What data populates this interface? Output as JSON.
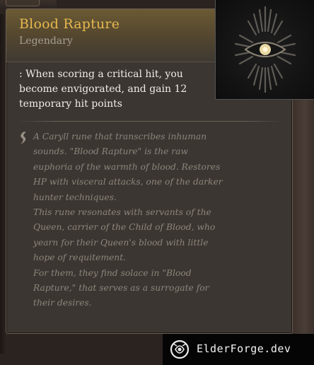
{
  "tooltip": {
    "title": "Blood Rapture",
    "rarity": "Legendary",
    "effect": ": When scoring a critical hit, you become envigorated, and gain 12 temporary hit points",
    "lore": [
      "A Caryll rune that transcribes inhuman sounds. \"Blood Rapture\" is the raw euphoria of the warmth of blood. Restores HP with visceral attacks, one of the darker hunter techniques.",
      "This rune resonates with servants of the Queen, carrier of the Child of Blood, who yearn for their Queen's blood with little hope of requitement.",
      "For them, they find solace in \"Blood Rapture,\" that serves as a surrogate for their desires."
    ],
    "icon": "caryll-rune-blood-rapture",
    "colors": {
      "title": "#e7b84f",
      "header_gold": "#6b5a34",
      "body": "#3b3632",
      "lore_text": "#8e857b"
    }
  },
  "watermark": {
    "text": "ElderForge.dev",
    "icon": "elderforge-logo-icon"
  }
}
